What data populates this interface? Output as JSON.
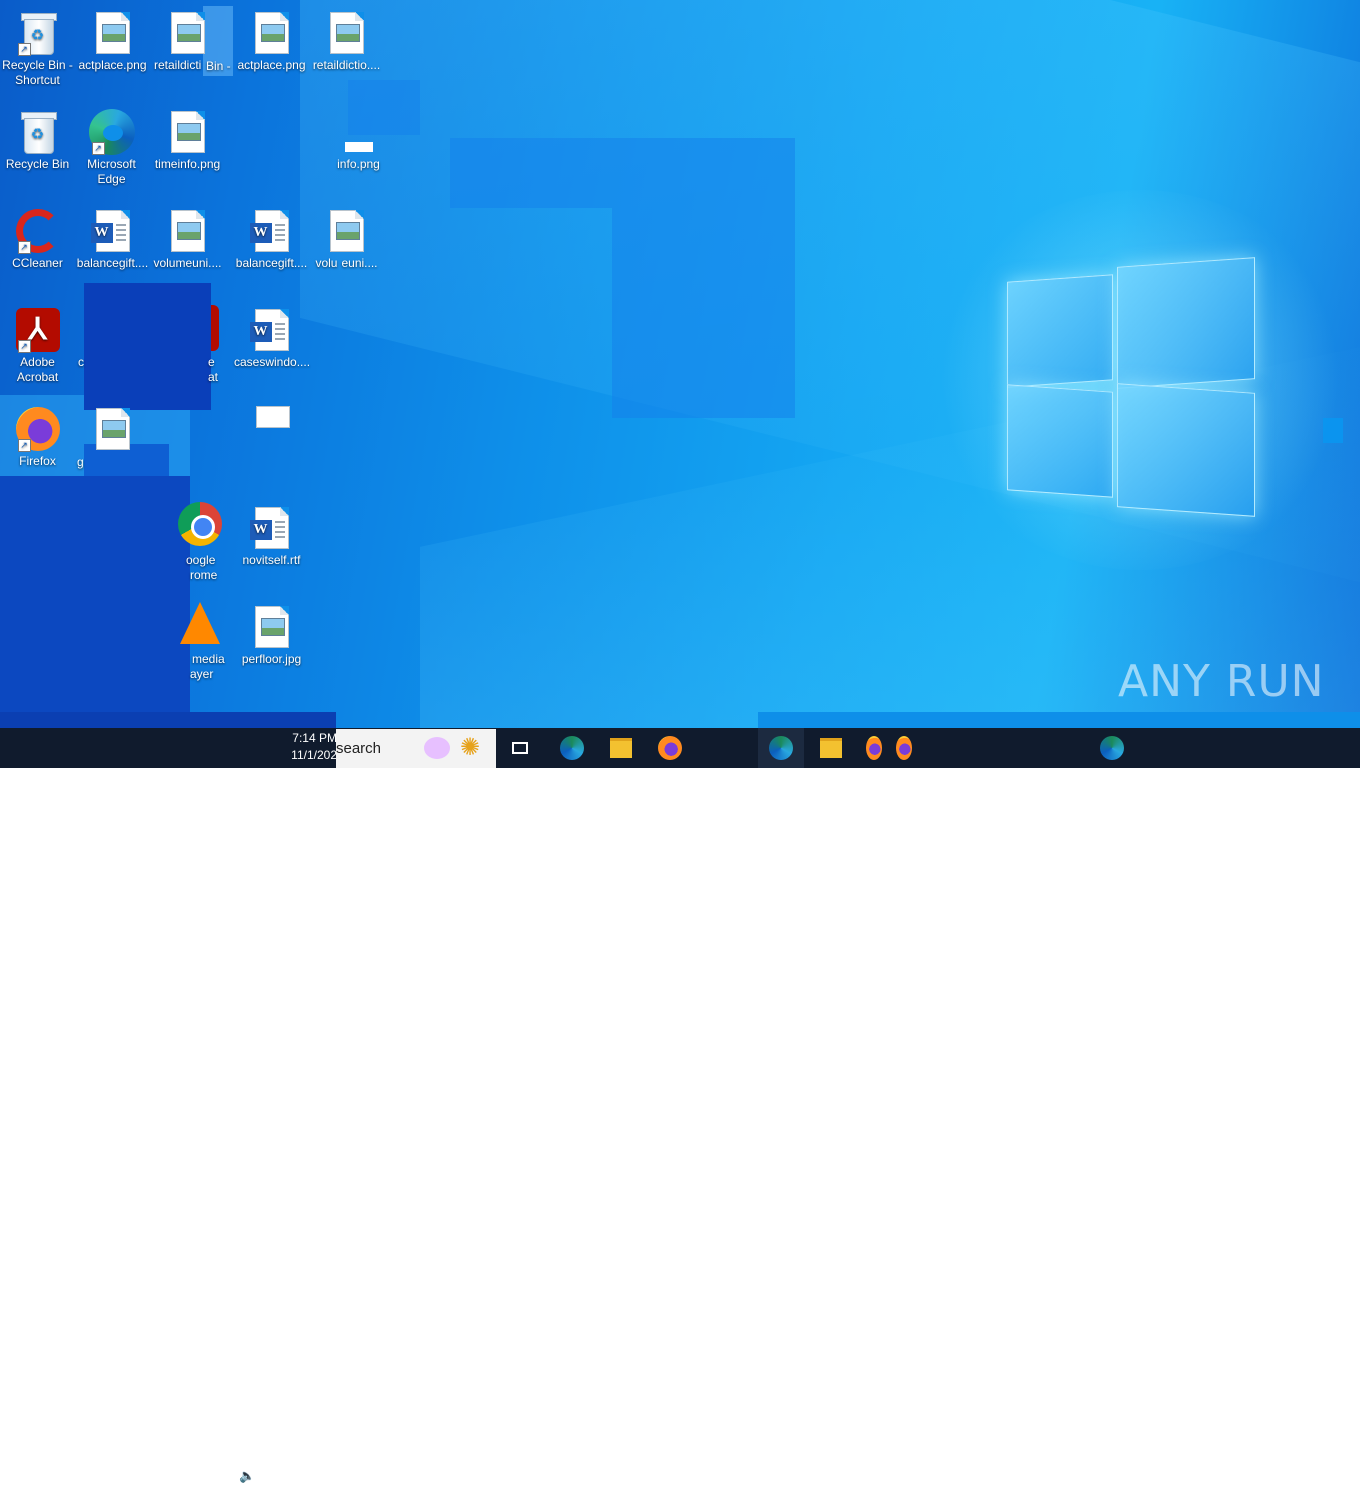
{
  "desktop_icons": {
    "col1": [
      {
        "label": "Recycle Bin - Shortcut",
        "icon": "recycle-bin-icon"
      },
      {
        "label": "Recycle Bin",
        "icon": "recycle-bin-icon"
      },
      {
        "label": "CCleaner",
        "icon": "ccleaner-icon"
      },
      {
        "label": "Adobe Acrobat",
        "icon": "acrobat-icon"
      },
      {
        "label": "Firefox",
        "icon": "firefox-icon"
      }
    ],
    "col2": [
      {
        "label": "actplace.png",
        "icon": "image-file-icon"
      },
      {
        "label": "Microsoft Edge",
        "icon": "edge-icon"
      },
      {
        "label": "balancegift....",
        "icon": "word-file-icon"
      },
      {
        "label": "c",
        "icon": "partial"
      },
      {
        "label": "g",
        "icon": "image-file-icon"
      }
    ],
    "col3": [
      {
        "label": "retaildicti",
        "icon": "image-file-icon"
      },
      {
        "label": "timeinfo.png",
        "icon": "image-file-icon"
      },
      {
        "label": "volumeuni....",
        "icon": "image-file-icon"
      },
      {
        "label": "e",
        "icon": "acrobat-icon"
      },
      {
        "label": "at",
        "icon": "partial"
      },
      {
        "label": "oogle",
        "icon": "chrome-icon"
      },
      {
        "label": "rome",
        "icon": "partial"
      },
      {
        "label": "media",
        "icon": "vlc-icon"
      },
      {
        "label": "ayer",
        "icon": "partial"
      }
    ],
    "col4": [
      {
        "label": "actplace.png",
        "icon": "image-file-icon"
      },
      {
        "label": "balancegift....",
        "icon": "word-file-icon"
      },
      {
        "label": "caseswindo....",
        "icon": "word-file-icon"
      },
      {
        "label": "novitself.rtf",
        "icon": "word-file-icon"
      },
      {
        "label": "perfloor.jpg",
        "icon": "image-file-icon"
      }
    ],
    "col5": [
      {
        "label": "retaildictio....",
        "icon": "image-file-icon"
      },
      {
        "label": "info.png",
        "icon": "image-file-icon"
      },
      {
        "label": "volu",
        "icon": "image-file-icon"
      },
      {
        "label": "euni....",
        "icon": "partial"
      }
    ],
    "overlap_label": "Bin -"
  },
  "taskbar": {
    "search_text": "search",
    "clock_time": "7:14 PM",
    "clock_date": "11/1/202",
    "tray_icons": [
      "chevron-up-icon",
      "network-icon",
      "volume-icon",
      "display-icon"
    ],
    "pinned": [
      "task-view-icon",
      "edge-icon",
      "file-explorer-icon",
      "firefox-icon"
    ],
    "ghost_pinned": [
      "edge-icon",
      "file-explorer-icon",
      "firefox-icon",
      "firefox-icon"
    ],
    "extra": [
      "edge-icon"
    ]
  },
  "watermark": "ANY RUN",
  "colors": {
    "taskbar": "#101b2d",
    "desktop_accent": "#0e8fe9"
  }
}
